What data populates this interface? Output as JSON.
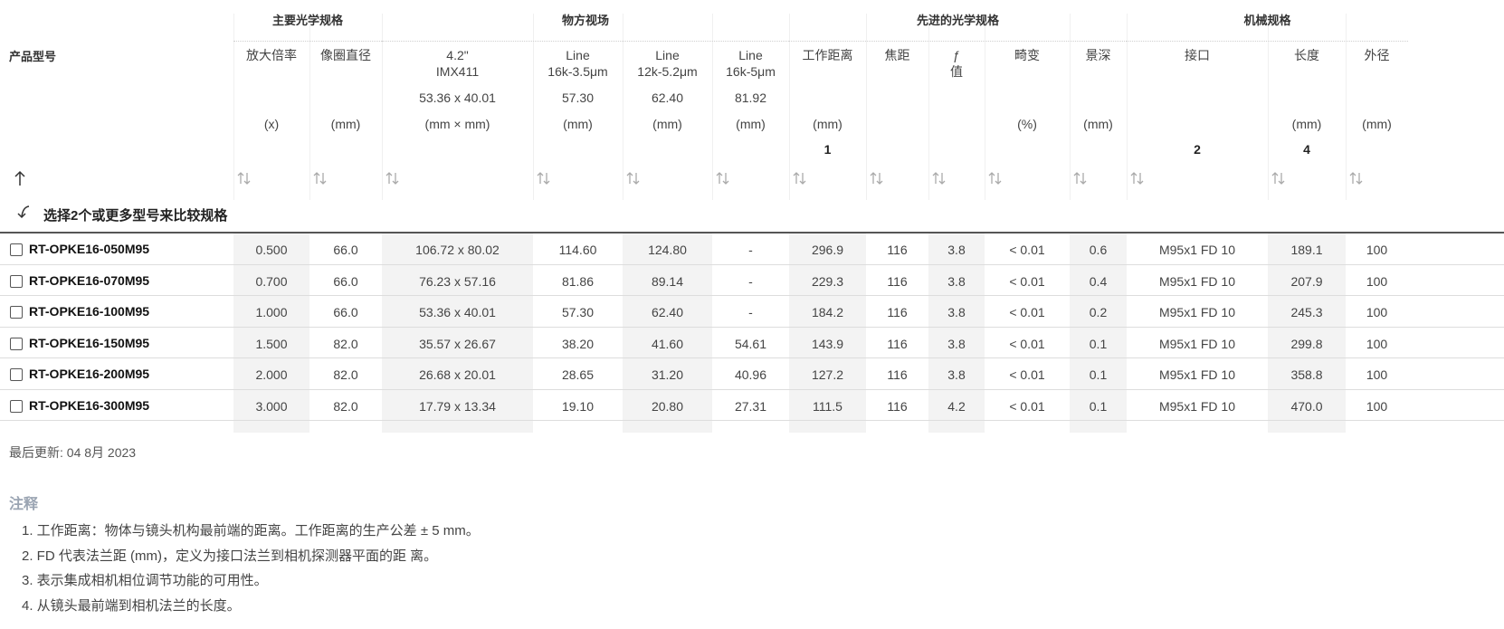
{
  "groups": [
    {
      "id": "main",
      "label": "主要光学规格"
    },
    {
      "id": "fov",
      "label": "物方视场"
    },
    {
      "id": "adv",
      "label": "先进的光学规格"
    },
    {
      "id": "mech",
      "label": "机械规格"
    }
  ],
  "model_header": "产品型号",
  "columns": [
    {
      "id": "mag",
      "label": "放大倍率",
      "unit": "(x)"
    },
    {
      "id": "img",
      "label": "像圈直径",
      "unit": "(mm)"
    },
    {
      "id": "imx",
      "label": "4.2\"\nIMX411",
      "value": "53.36 x 40.01",
      "unit": "(mm × mm)"
    },
    {
      "id": "l35",
      "label": "Line\n16k-3.5μm",
      "value": "57.30",
      "unit": "(mm)"
    },
    {
      "id": "l52",
      "label": "Line\n12k-5.2μm",
      "value": "62.40",
      "unit": "(mm)"
    },
    {
      "id": "l5",
      "label": "Line\n16k-5μm",
      "value": "81.92",
      "unit": "(mm)"
    },
    {
      "id": "wd",
      "label": "工作距离",
      "unit": "(mm)",
      "note": "1"
    },
    {
      "id": "fl",
      "label": "焦距"
    },
    {
      "id": "fno",
      "label": "ƒ\n值"
    },
    {
      "id": "dist",
      "label": "畸变",
      "unit": "(%)"
    },
    {
      "id": "dof",
      "label": "景深",
      "unit": "(mm)"
    },
    {
      "id": "mount",
      "label": "接口",
      "note": "2"
    },
    {
      "id": "len",
      "label": "长度",
      "unit": "(mm)",
      "note": "4"
    },
    {
      "id": "od",
      "label": "外径",
      "unit": "(mm)"
    }
  ],
  "compare_label": "选择2个或更多型号来比较规格",
  "rows": [
    {
      "model": "RT-OPKE16-050M95",
      "cells": [
        "0.500",
        "66.0",
        "106.72 x 80.02",
        "114.60",
        "124.80",
        "-",
        "296.9",
        "116",
        "3.8",
        "< 0.01",
        "0.6",
        "M95x1 FD 10",
        "189.1",
        "100"
      ]
    },
    {
      "model": "RT-OPKE16-070M95",
      "cells": [
        "0.700",
        "66.0",
        "76.23 x 57.16",
        "81.86",
        "89.14",
        "-",
        "229.3",
        "116",
        "3.8",
        "< 0.01",
        "0.4",
        "M95x1 FD 10",
        "207.9",
        "100"
      ]
    },
    {
      "model": "RT-OPKE16-100M95",
      "cells": [
        "1.000",
        "66.0",
        "53.36 x 40.01",
        "57.30",
        "62.40",
        "-",
        "184.2",
        "116",
        "3.8",
        "< 0.01",
        "0.2",
        "M95x1 FD 10",
        "245.3",
        "100"
      ]
    },
    {
      "model": "RT-OPKE16-150M95",
      "cells": [
        "1.500",
        "82.0",
        "35.57 x 26.67",
        "38.20",
        "41.60",
        "54.61",
        "143.9",
        "116",
        "3.8",
        "< 0.01",
        "0.1",
        "M95x1 FD 10",
        "299.8",
        "100"
      ]
    },
    {
      "model": "RT-OPKE16-200M95",
      "cells": [
        "2.000",
        "82.0",
        "26.68 x 20.01",
        "28.65",
        "31.20",
        "40.96",
        "127.2",
        "116",
        "3.8",
        "< 0.01",
        "0.1",
        "M95x1 FD 10",
        "358.8",
        "100"
      ]
    },
    {
      "model": "RT-OPKE16-300M95",
      "cells": [
        "3.000",
        "82.0",
        "17.79 x 13.34",
        "19.10",
        "20.80",
        "27.31",
        "111.5",
        "116",
        "4.2",
        "< 0.01",
        "0.1",
        "M95x1 FD 10",
        "470.0",
        "100"
      ]
    }
  ],
  "last_updated": "最后更新: 04 8月 2023",
  "notes_title": "注释",
  "notes": [
    "1. 工作距离：物体与镜头机构最前端的距离。工作距离的生产公差 ± 5 mm。",
    "2. FD 代表法兰距 (mm)，定义为接口法兰到相机探测器平面的距 离。",
    "3. 表示集成相机相位调节功能的可用性。",
    "4. 从镜头最前端到相机法兰的长度。"
  ],
  "icons": {
    "sort": "sort-arrows-icon",
    "up": "arrow-up-icon",
    "curve": "curved-arrow-down-left-icon"
  },
  "colors": {
    "stripe": "#f3f3f3",
    "notes_title": "#9aa4b2",
    "header_line": "#555555"
  }
}
